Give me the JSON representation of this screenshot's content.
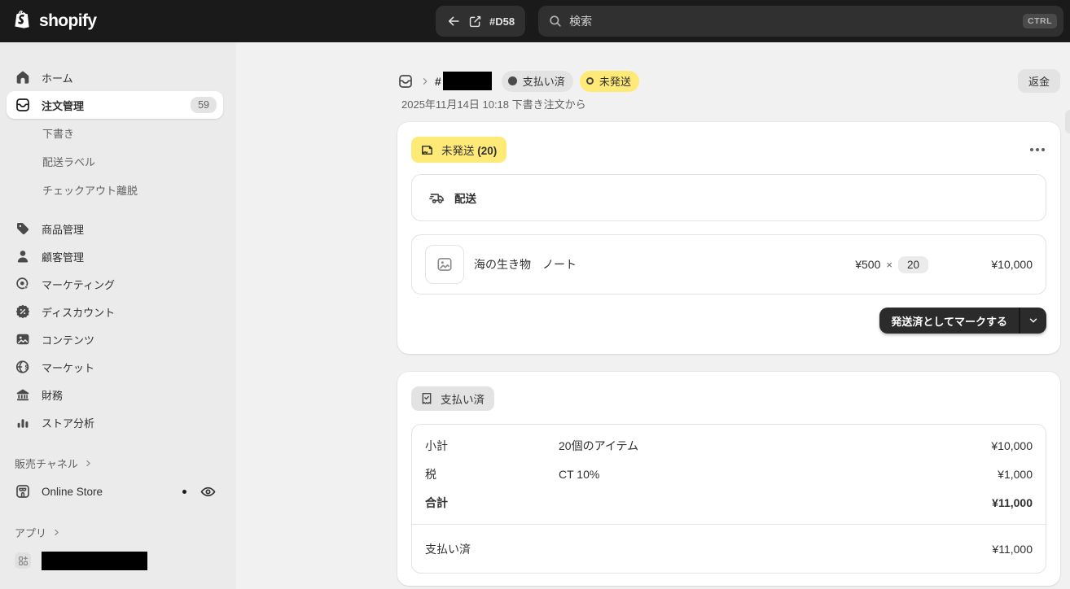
{
  "topbar": {
    "logo_text": "shopify",
    "order_ref": "#D58",
    "search_placeholder": "検索",
    "shortcut": "CTRL"
  },
  "sidebar": {
    "nav": [
      {
        "label": "ホーム",
        "icon": "home"
      },
      {
        "label": "注文管理",
        "icon": "orders",
        "badge": "59"
      },
      {
        "label": "下書き"
      },
      {
        "label": "配送ラベル"
      },
      {
        "label": "チェックアウト離脱"
      },
      {
        "label": "商品管理",
        "icon": "products-tag"
      },
      {
        "label": "顧客管理",
        "icon": "customers"
      },
      {
        "label": "マーケティング",
        "icon": "marketing-target"
      },
      {
        "label": "ディスカウント",
        "icon": "discount-seal"
      },
      {
        "label": "コンテンツ",
        "icon": "content-image"
      },
      {
        "label": "マーケット",
        "icon": "markets-globe"
      },
      {
        "label": "財務",
        "icon": "finance-bank"
      },
      {
        "label": "ストア分析",
        "icon": "analytics-bars"
      }
    ],
    "sales_channels_label": "販売チャネル",
    "online_store_label": "Online Store",
    "apps_label": "アプリ"
  },
  "header": {
    "order_prefix": "#",
    "paid_badge": "支払い済",
    "unfulfilled_badge": "未発送",
    "date_line": "2025年11月14日 10:18 下書き注文から",
    "refund_button": "返金"
  },
  "fulfillment_card": {
    "badge": "未発送 (20)",
    "shipping_label": "配送",
    "product": {
      "name": "海の生き物　ノート",
      "unit_price": "¥500",
      "multiply": "×",
      "quantity": "20",
      "line_total": "¥10,000"
    },
    "primary_button": "発送済としてマークする"
  },
  "payment_card": {
    "badge": "支払い済",
    "rows": [
      {
        "label": "小計",
        "detail": "20個のアイテム",
        "amount": "¥10,000"
      },
      {
        "label": "税",
        "detail": "CT 10%",
        "amount": "¥1,000"
      },
      {
        "label": "合計",
        "detail": "",
        "amount": "¥11,000"
      }
    ],
    "paid_row": {
      "label": "支払い済",
      "amount": "¥11,000"
    }
  },
  "colors": {
    "topbar_bg": "#1a1a1a",
    "topbar_field_bg": "#303030",
    "sidebar_bg": "#ebebeb",
    "main_bg": "#f1f1f1",
    "card_bg": "#ffffff",
    "warning_yellow": "#ffe977",
    "neutral_badge": "#e3e3e3",
    "primary_button": "#2b2b2b",
    "text_primary": "#303030",
    "text_secondary": "#616161"
  }
}
